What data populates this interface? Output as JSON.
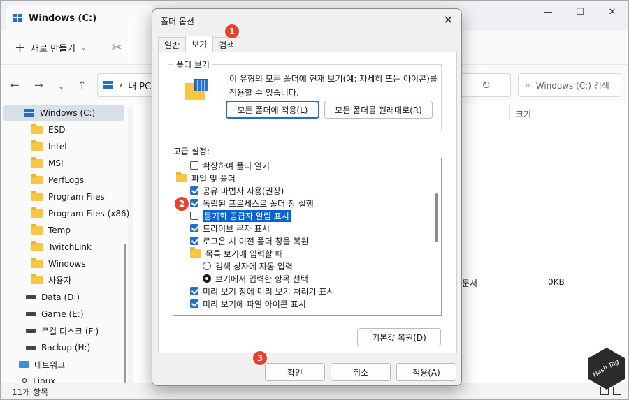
{
  "explorer": {
    "tab_title": "Windows (C:)",
    "new_label": "새로 만들기",
    "address_part": "내 PC",
    "search_placeholder": "Windows (C:) 검색",
    "column_size": "크기",
    "sidebar": [
      {
        "label": "Windows (C:)",
        "icon": "drive-icon",
        "selected": true
      },
      {
        "label": "ESD",
        "icon": "folder-icon"
      },
      {
        "label": "Intel",
        "icon": "folder-icon"
      },
      {
        "label": "MSI",
        "icon": "folder-icon"
      },
      {
        "label": "PerfLogs",
        "icon": "folder-icon"
      },
      {
        "label": "Program Files",
        "icon": "folder-icon"
      },
      {
        "label": "Program Files (x86)",
        "icon": "folder-icon"
      },
      {
        "label": "Temp",
        "icon": "folder-icon"
      },
      {
        "label": "TwitchLink",
        "icon": "folder-icon"
      },
      {
        "label": "Windows",
        "icon": "folder-icon"
      },
      {
        "label": "사용자",
        "icon": "folder-icon"
      },
      {
        "label": "Data (D:)",
        "icon": "disk-icon"
      },
      {
        "label": "Game (E:)",
        "icon": "disk-icon"
      },
      {
        "label": "로컬 디스크 (F:)",
        "icon": "disk-icon"
      },
      {
        "label": "Backup (H:)",
        "icon": "disk-icon"
      },
      {
        "label": "네트워크",
        "icon": "network-icon"
      },
      {
        "label": "Linux",
        "icon": "linux-icon"
      }
    ],
    "doc_type": "문서",
    "file_size": "0KB",
    "status": "11개 항목",
    "watermark": "Hash Tag"
  },
  "dialog": {
    "title": "폴더 옵션",
    "tabs": [
      "일반",
      "보기",
      "검색"
    ],
    "group_title": "폴더 보기",
    "group_desc": "이 유형의 모든 폴더에 현재 보기(예: 자세히 또는 아이콘)를 적용할 수 있습니다.",
    "apply_all": "모든 폴더에 적용(L)",
    "reset_folders": "모든 폴더를 원래대로(R)",
    "advanced_label": "고급 설정:",
    "items": [
      {
        "type": "checkbox",
        "checked": false,
        "label": "확장하여 폴더 열기",
        "indent": 1
      },
      {
        "type": "folder",
        "label": "파일 및 폴더",
        "indent": 0
      },
      {
        "type": "checkbox",
        "checked": true,
        "label": "공유 마법사 사용(권장)",
        "indent": 1
      },
      {
        "type": "checkbox",
        "checked": true,
        "label": "독립된 프로세스로 폴더 창 실행",
        "indent": 1
      },
      {
        "type": "checkbox",
        "checked": false,
        "label": "동기화 공급자 알림 표시",
        "indent": 1,
        "highlight": true
      },
      {
        "type": "checkbox",
        "checked": true,
        "label": "드라이브 문자 표시",
        "indent": 1
      },
      {
        "type": "checkbox",
        "checked": true,
        "label": "로그온 시 이전 폴더 창을 복원",
        "indent": 1
      },
      {
        "type": "folder",
        "label": "목록 보기에 입력할 때",
        "indent": 1
      },
      {
        "type": "radio",
        "checked": false,
        "label": "검색 상자에 자동 입력",
        "indent": 2
      },
      {
        "type": "radio",
        "checked": true,
        "label": "보기에서 입력한 항목 선택",
        "indent": 2
      },
      {
        "type": "checkbox",
        "checked": true,
        "label": "미리 보기 창에 미리 보기 처리기 표시",
        "indent": 1
      },
      {
        "type": "checkbox",
        "checked": true,
        "label": "미리 보기에 파일 아이콘 표시",
        "indent": 1
      }
    ],
    "restore_defaults": "기본값 복원(D)",
    "ok": "확인",
    "cancel": "취소",
    "apply": "적용(A)"
  },
  "badges": [
    "1",
    "2",
    "3"
  ],
  "colors": {
    "accent": "#1f6fd0",
    "highlight": "#0a63d4",
    "badge": "#e8402b",
    "folder": "#f7c744"
  }
}
